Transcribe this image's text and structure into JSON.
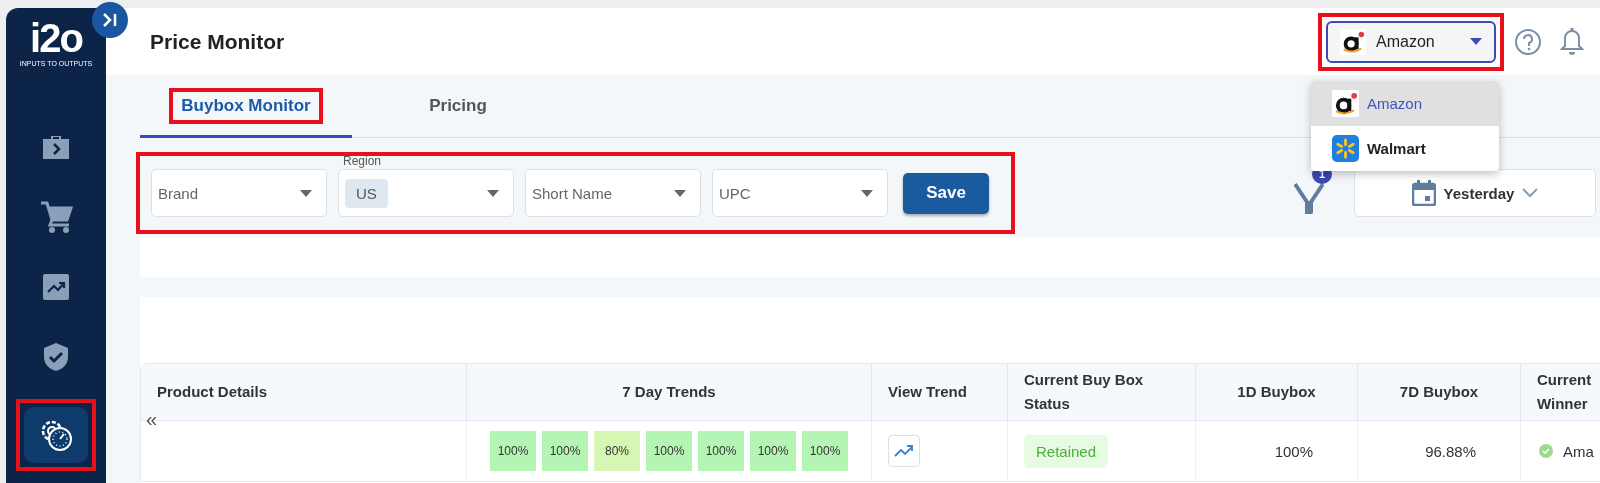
{
  "sidebar": {
    "logo": {
      "text": "i2o",
      "tagline": "INPUTS TO OUTPUTS"
    },
    "items": [
      {
        "kind": "briefcase",
        "selected": false,
        "highlighted": false
      },
      {
        "kind": "cart",
        "selected": false,
        "highlighted": false
      },
      {
        "kind": "chart",
        "selected": false,
        "highlighted": false
      },
      {
        "kind": "shield",
        "selected": false,
        "highlighted": false
      },
      {
        "kind": "gear-timer",
        "selected": true,
        "highlighted": true
      }
    ]
  },
  "header": {
    "title": "Price Monitor",
    "marketplace": {
      "value": "Amazon",
      "kind": "amazon",
      "highlighted": true,
      "expanded": true
    }
  },
  "marketplace_menu": [
    {
      "label": "Amazon",
      "kind": "amazon",
      "selected": true
    },
    {
      "label": "Walmart",
      "kind": "walmart",
      "selected": false
    }
  ],
  "tabs": [
    {
      "label": "Buybox Monitor",
      "selected": true,
      "highlighted": true
    },
    {
      "label": "Pricing",
      "selected": false,
      "highlighted": false
    }
  ],
  "filters": {
    "highlighted": true,
    "fields": [
      {
        "placeholder": "Brand"
      },
      {
        "label": "Region",
        "chips": [
          "US"
        ]
      },
      {
        "placeholder": "Short Name"
      },
      {
        "placeholder": "UPC"
      }
    ],
    "save": "Save",
    "filter_badge": "1",
    "date_range": "Yesterday"
  },
  "table": {
    "columns": [
      "Product Details",
      "7 Day Trends",
      "View Trend",
      "Current Buy Box Status",
      "1D Buybox",
      "7D Buybox",
      "Current Winner"
    ],
    "collapse": "«",
    "rows": [
      {
        "trends": [
          {
            "value": "100%",
            "color": "#b5f5b3"
          },
          {
            "value": "100%",
            "color": "#b5f5b3"
          },
          {
            "value": "80%",
            "color": "#d5f7b3"
          },
          {
            "value": "100%",
            "color": "#b5f5b3"
          },
          {
            "value": "100%",
            "color": "#b5f5b3"
          },
          {
            "value": "100%",
            "color": "#b5f5b3"
          },
          {
            "value": "100%",
            "color": "#b5f5b3"
          }
        ],
        "status": "Retained",
        "buybox_1d": "100%",
        "buybox_7d": "96.88%",
        "winner": "Ama"
      }
    ]
  }
}
